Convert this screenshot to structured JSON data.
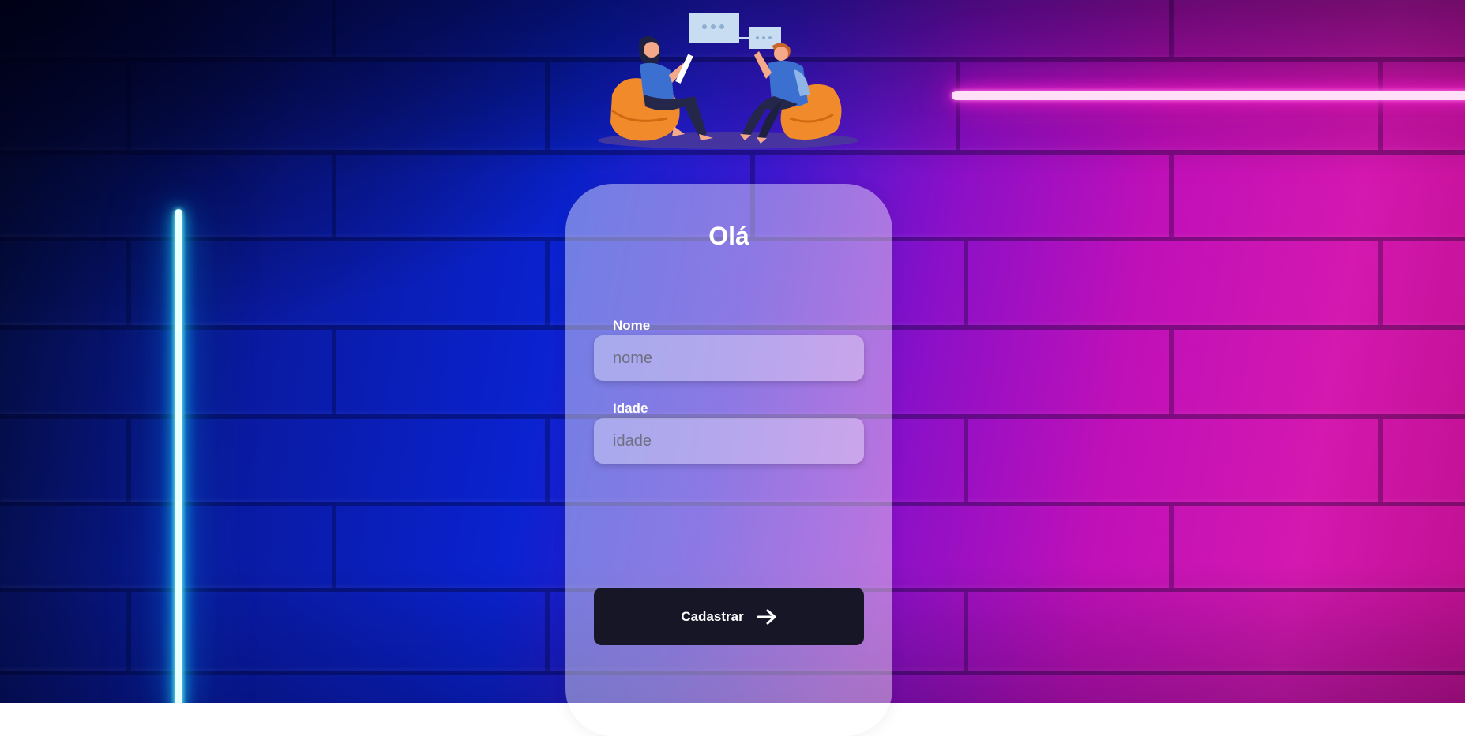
{
  "card": {
    "title": "Olá"
  },
  "form": {
    "name_label": "Nome",
    "name_placeholder": "nome",
    "name_value": "",
    "age_label": "Idade",
    "age_placeholder": "idade",
    "age_value": "",
    "submit_label": "Cadastrar"
  },
  "icons": {
    "submit": "arrow-right-icon",
    "illustration": "chat-conversation-illustration"
  },
  "colors": {
    "button_bg": "#161626",
    "neon_cyan": "#22eeff",
    "neon_pink": "#ff2ad8",
    "bean_bag": "#f08a2a"
  }
}
